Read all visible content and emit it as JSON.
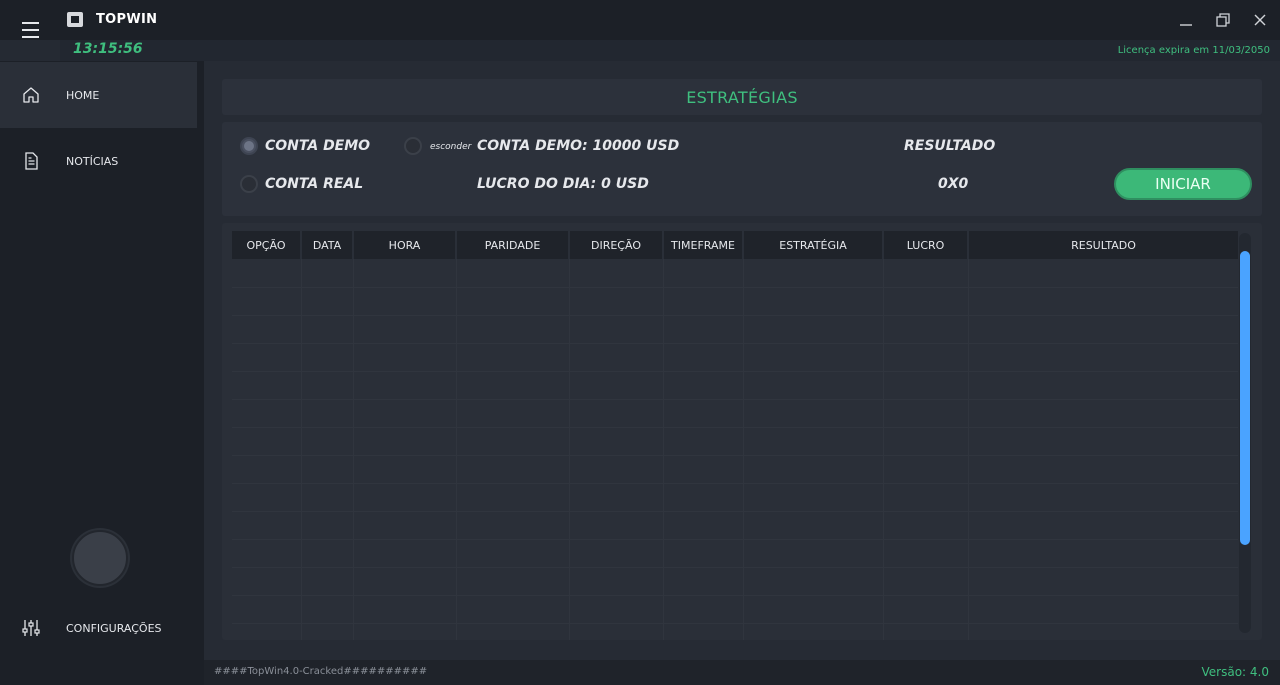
{
  "app": {
    "title": "TOPWIN",
    "clock": "13:15:56",
    "license": "Licença expira em 11/03/2050"
  },
  "sidebar": {
    "items": [
      {
        "label": "HOME",
        "icon": "home-icon"
      },
      {
        "label": "NOTÍCIAS",
        "icon": "document-icon"
      },
      {
        "label": "CONFIGURAÇÕES",
        "icon": "sliders-icon"
      }
    ]
  },
  "main": {
    "title": "ESTRATÉGIAS",
    "conta_demo": "CONTA DEMO",
    "conta_real": "CONTA REAL",
    "esconder": "esconder",
    "saldo": "CONTA DEMO: 10000 USD",
    "lucro": "LUCRO DO DIA: 0 USD",
    "resultado_label": "RESULTADO",
    "resultado_value": "0X0",
    "start_button": "INICIAR"
  },
  "table": {
    "columns": [
      "OPÇÃO",
      "DATA",
      "HORA",
      "PARIDADE",
      "DIREÇÃO",
      "TIMEFRAME",
      "ESTRATÉGIA",
      "LUCRO",
      "RESULTADO"
    ]
  },
  "status": {
    "left": "####TopWin4.0-Cracked##########",
    "right": "Versão: 4.0"
  },
  "colors": {
    "accent": "#3fbf7f",
    "scrollbar": "#4aa3ff"
  }
}
